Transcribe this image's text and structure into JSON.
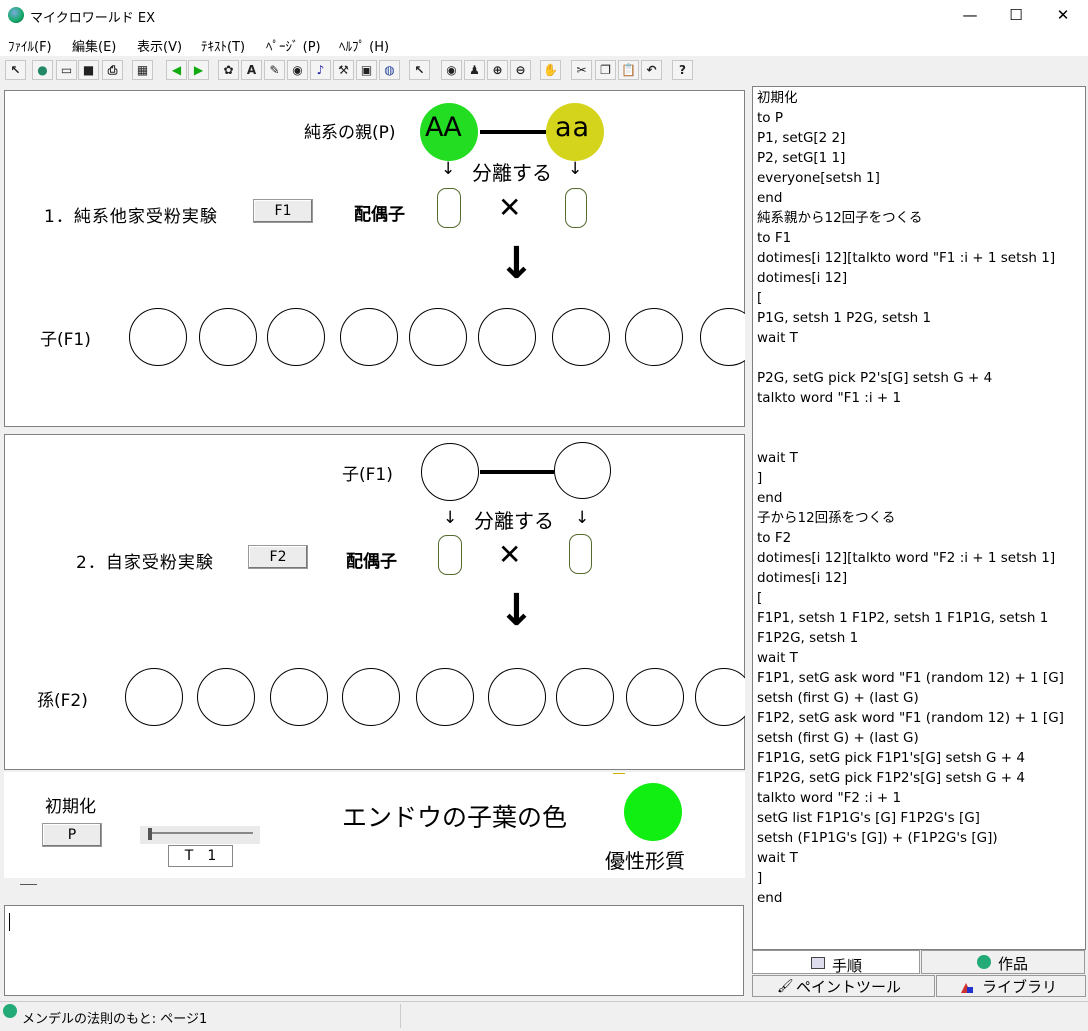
{
  "window": {
    "title": "マイクロワールド EX",
    "minimize": "—",
    "maximize": "☐",
    "close": "✕"
  },
  "menu": [
    "ﾌｧｲﾙ(F)",
    "編集(E)",
    "表示(V)",
    "ﾃｷｽﾄ(T)",
    "ﾍﾟｰｼﾞ (P)",
    "ﾍﾙﾌﾟ (H)"
  ],
  "toolbar": {
    "icons": [
      "cursor-icon",
      "globe-icon",
      "open-icon",
      "save-icon",
      "print-icon",
      "layout-icon",
      "back-arrow-icon",
      "forward-arrow-icon",
      "turtle-icon",
      "text-box-icon",
      "drawing-icon",
      "eye-stamp-icon",
      "music-icon",
      "tools-icon",
      "video-icon",
      "web-icon",
      "pointer-icon",
      "eye-icon",
      "stamp-icon",
      "zoom-in-icon",
      "zoom-out-icon",
      "stop-hand-icon",
      "scissors-icon",
      "copy-icon",
      "paste-icon",
      "undo-icon",
      "help-icon"
    ],
    "help_label": "?"
  },
  "exp1": {
    "parent_label": "純系の親(P)",
    "parent1_genotype": "AA",
    "parent2_genotype": "aa",
    "separate_label": "分離する",
    "arrow_left": "↓",
    "arrow_right": "↓",
    "title": "1．純系他家受粉実験",
    "button": "F1",
    "gamete_label": "配偶子",
    "cross": "✕",
    "down_arrow": "↓",
    "offspring_label": "子(F1)",
    "offspring_count": 9
  },
  "exp2": {
    "parent_label": "子(F1)",
    "separate_label": "分離する",
    "arrow_left": "↓",
    "arrow_right": "↓",
    "title": "2．自家受粉実験",
    "button": "F2",
    "gamete_label": "配偶子",
    "cross": "✕",
    "down_arrow": "↓",
    "offspring_label": "孫(F2)",
    "offspring_count": 9
  },
  "controls": {
    "init_label": "初期化",
    "init_button": "P",
    "slider_value": "T　1",
    "pea_title": "エンドウの子葉の色",
    "dominant_label": "優性形質"
  },
  "colors": {
    "green": "#22dd22",
    "yellow": "#d4d41c",
    "dominant": "#11ee11"
  },
  "procedures": [
    "初期化",
    "to P",
    "P1, setG[2 2]",
    "P2, setG[1 1]",
    "everyone[setsh 1]",
    "end",
    "純系親から12回子をつくる",
    "to F1",
    "dotimes[i 12][talkto word \"F1 :i + 1 setsh 1]",
    "dotimes[i 12]",
    "[",
    "P1G, setsh 1 P2G, setsh 1",
    "wait T",
    "",
    "P2G,  setG pick P2's[G] setsh G + 4",
    "talkto word \"F1 :i + 1",
    "",
    "",
    "wait T",
    "]",
    "end",
    "子から12回孫をつくる",
    "to F2",
    "dotimes[i 12][talkto word \"F2 :i + 1 setsh 1]",
    "dotimes[i 12]",
    "[",
    "F1P1, setsh 1 F1P2, setsh 1 F1P1G, setsh 1",
    "F1P2G, setsh 1",
    "wait T",
    "F1P1, setG ask word \"F1 (random 12) + 1 [G]",
    " setsh (first G) + (last G)",
    "F1P2, setG ask word \"F1 (random 12) + 1 [G]",
    " setsh (first G) + (last G)",
    "F1P1G, setG pick F1P1's[G]  setsh G + 4",
    "F1P2G,  setG pick F1P2's[G] setsh G + 4",
    "talkto word \"F2 :i + 1",
    "setG list F1P1G's [G]  F1P2G's [G]",
    "setsh (F1P1G's [G]) + (F1P2G's [G])",
    "wait T",
    "]",
    "end"
  ],
  "tabs": {
    "procedures": "手順",
    "project": "作品",
    "paint": "ペイントツール",
    "library": "ライブラリ"
  },
  "status": {
    "text": "メンデルの法則のもと: ページ1"
  }
}
